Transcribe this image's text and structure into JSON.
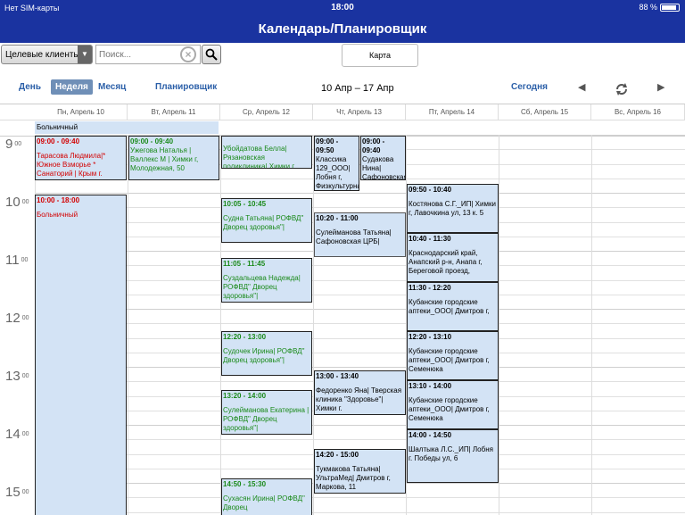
{
  "status": {
    "carrier": "Нет SIM-карты",
    "time": "18:00",
    "battery": "88 %"
  },
  "title": "Календарь/Планировщик",
  "toolbar": {
    "filter": "Целевые клиенть",
    "search_placeholder": "Поиск...",
    "map": "Карта"
  },
  "nav": {
    "day": "День",
    "week": "Неделя",
    "month": "Месяц",
    "planner": "Планировщик",
    "range": "10 Апр – 17 Апр",
    "today": "Сегодня"
  },
  "days": [
    "Пн, Апрель 10",
    "Вт, Апрель 11",
    "Ср, Апрель 12",
    "Чт, Апрель 13",
    "Пт, Апрель 14",
    "Сб, Апрель 15",
    "Вс, Апрель 16"
  ],
  "allday": {
    "label": "Больничный"
  },
  "hours": [
    {
      "h": "9",
      "m": "00"
    },
    {
      "h": "10",
      "m": "00"
    },
    {
      "h": "11",
      "m": "00"
    },
    {
      "h": "12",
      "m": "00"
    },
    {
      "h": "13",
      "m": "00"
    },
    {
      "h": "14",
      "m": "00"
    },
    {
      "h": "15",
      "m": "00"
    }
  ],
  "events": [
    {
      "t": "09:00 - 09:40",
      "d": "Тарасова Людмила|* Южное Взморье * Санаторий | Крым г.",
      "color": "red"
    },
    {
      "t": "10:00 - 18:00",
      "d": "Больничный",
      "color": "red"
    },
    {
      "t": "09:00 - 09:40",
      "d": "Ужегова Наталья | Валлекс М | Химки г, Молодежная, 50",
      "color": "green"
    },
    {
      "t": "",
      "d": "Убойдатова Белла| Рязановская поликлиника| Химки г.",
      "color": "green"
    },
    {
      "t": "10:05 - 10:45",
      "d": "Судна Татьяна| РОФВД\" Дворец здоровья\"|",
      "color": "green"
    },
    {
      "t": "11:05 - 11:45",
      "d": "Суздальцева Надежда|РОФВД\" Дворец здоровья\"|",
      "color": "green"
    },
    {
      "t": "12:20 - 13:00",
      "d": "Судочек Ирина| РОФВД\" Дворец здоровья\"|",
      "color": "green"
    },
    {
      "t": "13:20 - 14:00",
      "d": "Сулейманова Екатерина |РОФВД\" Дворец здоровья\"|",
      "color": "green"
    },
    {
      "t": "14:50 - 15:30",
      "d": "Сухасян Ирина| РОФВД\" Дворец",
      "color": "green"
    },
    {
      "t": "09:00 - 09:50",
      "d": "Классика 129_ООО| Лобня г, Физкультурная",
      "color": "black"
    },
    {
      "t": "09:00 - 09:40",
      "d": "Судакова Нина| Сафоновская",
      "color": "black"
    },
    {
      "t": "10:20 - 11:00",
      "d": "Сулейманова Татьяна| Сафоновская ЦРБ|",
      "color": "black"
    },
    {
      "t": "13:00 - 13:40",
      "d": "Федоренко Яна| Тверская клиника \"Здоровье\"| Химки г.",
      "color": "black"
    },
    {
      "t": "14:20 - 15:00",
      "d": "Тукмакова Татьяна| УльтраМед| Дмитров г, Маркова, 11",
      "color": "black"
    },
    {
      "t": "09:50 - 10:40",
      "d": "Костянова С.Г._ИП| Химки г, Лавочкина ул, 13 к. 5",
      "color": "black"
    },
    {
      "t": "10:40 - 11:30",
      "d": "Краснодарский край, Анапский р-н, Анапа г, Береговой проезд,",
      "color": "black"
    },
    {
      "t": "11:30 - 12:20",
      "d": "Кубанские городские аптеки_ООО| Дмитров г,",
      "color": "black"
    },
    {
      "t": "12:20 - 13:10",
      "d": "Кубанские городские аптеки_ООО| Дмитров г, Семенюка",
      "color": "black"
    },
    {
      "t": "13:10 - 14:00",
      "d": "Кубанские городские аптеки_ООО| Дмитров г, Семенюка",
      "color": "black"
    },
    {
      "t": "14:00 - 14:50",
      "d": "Шалтыка Л.С._ИП| Лобня г. Победы ул, 6",
      "color": "black"
    }
  ]
}
